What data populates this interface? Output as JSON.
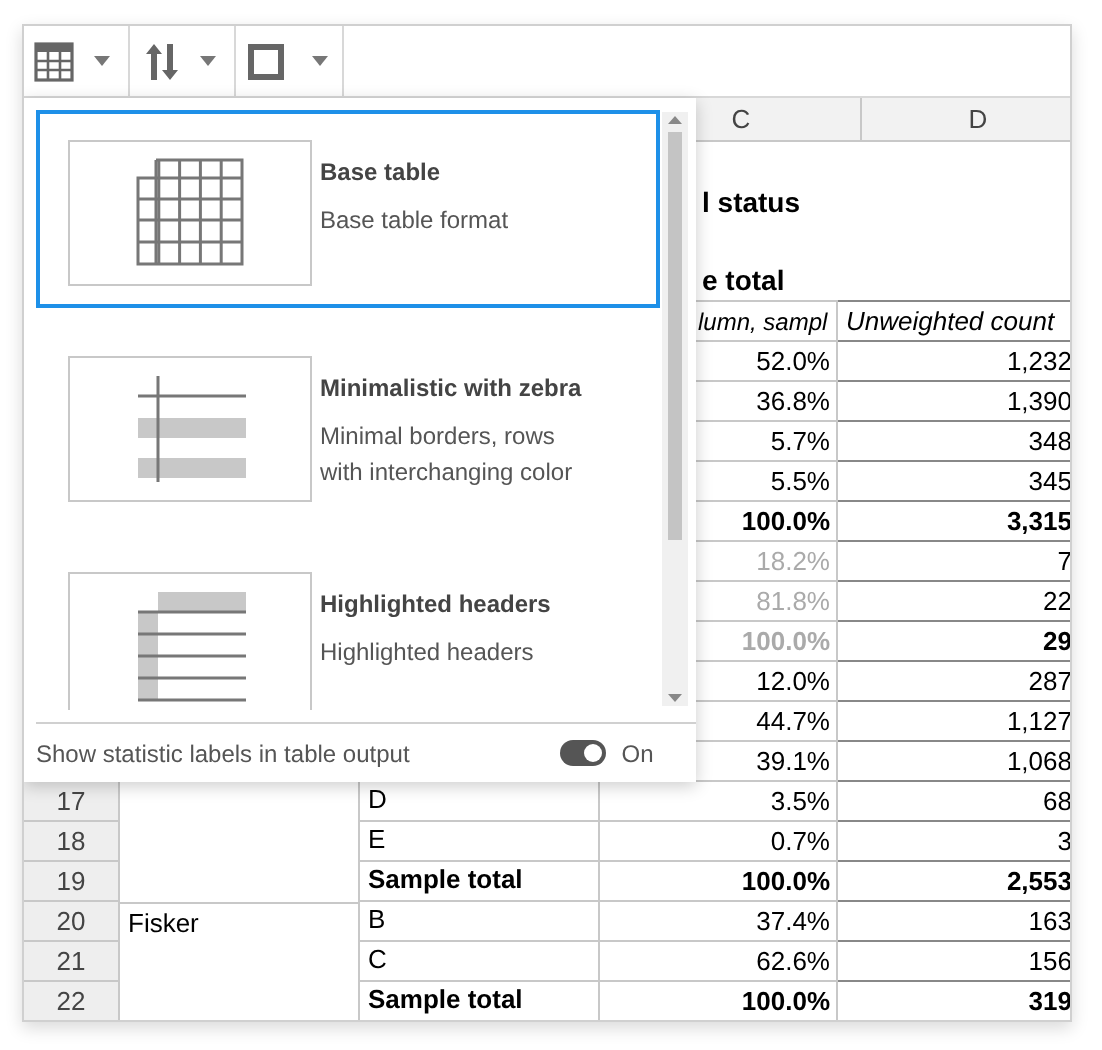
{
  "sheet": {
    "column_headers": [
      "C",
      "D"
    ],
    "rows": [
      {
        "kind": "title",
        "c": "l status"
      },
      {
        "kind": "heading",
        "c": "e total"
      },
      {
        "kind": "labels",
        "c": "lumn, sampl",
        "d": "Unweighted count"
      },
      {
        "kind": "value",
        "c": "52.0%",
        "d": "1,232"
      },
      {
        "kind": "value",
        "c": "36.8%",
        "d": "1,390"
      },
      {
        "kind": "value",
        "c": "5.7%",
        "d": "348"
      },
      {
        "kind": "value",
        "c": "5.5%",
        "d": "345"
      },
      {
        "kind": "total",
        "c": "100.0%",
        "d": "3,315"
      },
      {
        "kind": "muted",
        "c": "18.2%",
        "d": "7"
      },
      {
        "kind": "muted",
        "c": "81.8%",
        "d": "22"
      },
      {
        "kind": "muted_total",
        "c": "100.0%",
        "d": "29"
      },
      {
        "kind": "value",
        "c": "12.0%",
        "d": "287"
      },
      {
        "kind": "value",
        "c": "44.7%",
        "d": "1,127"
      },
      {
        "kind": "value",
        "c": "39.1%",
        "d": "1,068"
      },
      {
        "kind": "value",
        "number": "17",
        "b": "D",
        "c": "3.5%",
        "d": "68"
      },
      {
        "kind": "value",
        "number": "18",
        "b": "E",
        "c": "0.7%",
        "d": "3"
      },
      {
        "kind": "total",
        "number": "19",
        "b": "Sample total",
        "c": "100.0%",
        "d": "2,553"
      },
      {
        "kind": "value",
        "number": "20",
        "a": "Fisker",
        "b": "B",
        "c": "37.4%",
        "d": "163"
      },
      {
        "kind": "value",
        "number": "21",
        "b": "C",
        "c": "62.6%",
        "d": "156"
      },
      {
        "kind": "total",
        "number": "22",
        "b": "Sample total",
        "c": "100.0%",
        "d": "319"
      }
    ]
  },
  "style_menu": {
    "styles": [
      {
        "kind": "grid",
        "title": "Base table",
        "description": "Base table format",
        "selected": true
      },
      {
        "kind": "zebra",
        "title": "Minimalistic with zebra",
        "description": "Minimal borders, rows with interchanging color",
        "selected": false
      },
      {
        "kind": "highlighted",
        "title": "Highlighted headers",
        "description": "Highlighted headers",
        "selected": false
      }
    ],
    "footer": {
      "label": "Show statistic labels in table output",
      "on": true,
      "state": "On"
    }
  }
}
